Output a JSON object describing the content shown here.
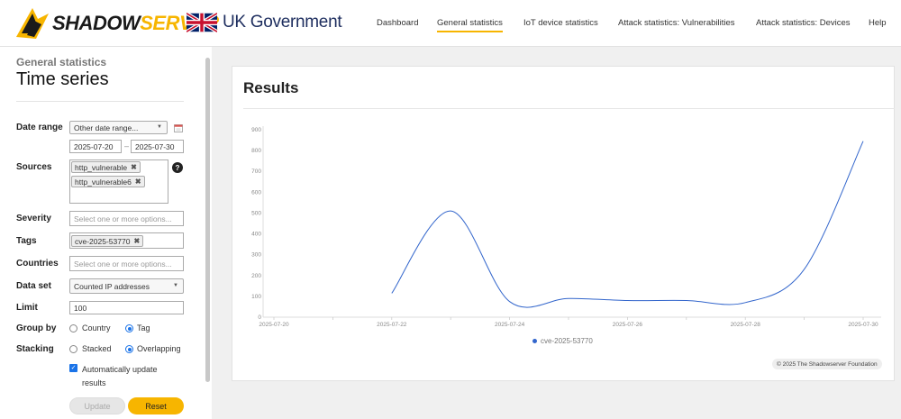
{
  "header": {
    "logo": {
      "part1": "SHADOW",
      "part2": "SERVER",
      "icon": "shadowserver-logo-icon"
    },
    "partner": {
      "text": "UK Government",
      "flag_icon": "union-jack-flag-icon"
    },
    "nav": [
      {
        "label": "Dashboard",
        "active": false
      },
      {
        "label": "General statistics",
        "active": true
      },
      {
        "label": "IoT device statistics",
        "active": false
      },
      {
        "label": "Attack statistics: Vulnerabilities",
        "active": false
      },
      {
        "label": "Attack statistics: Devices",
        "active": false
      },
      {
        "label": "Help",
        "active": false
      }
    ],
    "accent_color": "#f7b500"
  },
  "sidebar": {
    "subtitle": "General statistics",
    "title": "Time series",
    "date_range": {
      "label": "Date range",
      "selected": "Other date range...",
      "from": "2025-07-20",
      "to": "2025-07-30",
      "separator": "–"
    },
    "sources": {
      "label": "Sources",
      "tags": [
        "http_vulnerable",
        "http_vulnerable6"
      ],
      "help": "?"
    },
    "severity": {
      "label": "Severity",
      "placeholder": "Select one or more options..."
    },
    "tags": {
      "label": "Tags",
      "tags": [
        "cve-2025-53770"
      ]
    },
    "countries": {
      "label": "Countries",
      "placeholder": "Select one or more options..."
    },
    "dataset": {
      "label": "Data set",
      "selected": "Counted IP addresses"
    },
    "limit": {
      "label": "Limit",
      "value": "100"
    },
    "group_by": {
      "label": "Group by",
      "options": [
        "Country",
        "Tag"
      ],
      "selected": "Tag"
    },
    "stacking": {
      "label": "Stacking",
      "options": [
        "Stacked",
        "Overlapping"
      ],
      "selected": "Overlapping"
    },
    "auto_update": {
      "label": "Automatically update results",
      "checked": true
    },
    "buttons": {
      "update": "Update",
      "reset": "Reset"
    }
  },
  "results": {
    "title": "Results",
    "credit": "© 2025 The Shadowserver Foundation"
  },
  "chart_data": {
    "type": "line",
    "ylim": [
      0,
      900
    ],
    "yticks": [
      "0",
      "100",
      "200",
      "300",
      "400",
      "500",
      "600",
      "700",
      "800",
      "900"
    ],
    "xticks": [
      "2025-07-20",
      "2025-07-22",
      "2025-07-24",
      "2025-07-26",
      "2025-07-28",
      "2025-07-30"
    ],
    "xlim": [
      "2025-07-20",
      "2025-07-30"
    ],
    "series": [
      {
        "name": "cve-2025-53770",
        "color": "#3366cc",
        "x": [
          "2025-07-22",
          "2025-07-23",
          "2025-07-24",
          "2025-07-25",
          "2025-07-26",
          "2025-07-27",
          "2025-07-28",
          "2025-07-29",
          "2025-07-30"
        ],
        "values": [
          115,
          510,
          75,
          90,
          80,
          80,
          70,
          230,
          845
        ]
      }
    ]
  }
}
